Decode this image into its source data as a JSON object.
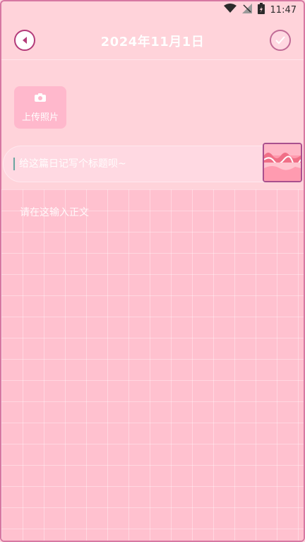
{
  "status": {
    "time": "11:47",
    "icons": [
      "wifi-icon",
      "no-signal-icon",
      "battery-icon"
    ]
  },
  "header": {
    "title": "2024年11月1日",
    "back_icon": "back-arrow-icon",
    "confirm_icon": "check-icon"
  },
  "upload": {
    "label": "上传照片",
    "icon": "camera-icon"
  },
  "title_input": {
    "placeholder": "给这篇日记写个标题呗~"
  },
  "body_input": {
    "placeholder": "请在这输入正文"
  },
  "colors": {
    "background": "#ffd3da",
    "accent": "#b33b7a",
    "grid": "#ffc1cf",
    "upload_bg": "#ffb8cc"
  }
}
